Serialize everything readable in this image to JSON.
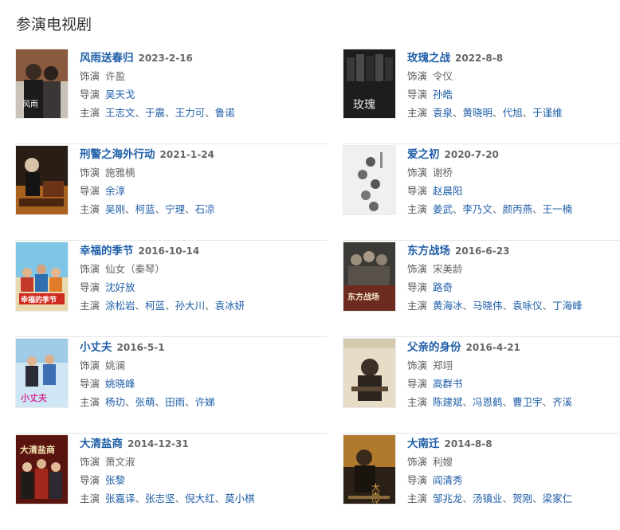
{
  "section_title": "参演电视剧",
  "labels": {
    "role": "饰演",
    "director": "导演",
    "cast": "主演"
  },
  "shows": [
    {
      "title": "风雨送春归",
      "date": "2023-2-16",
      "role": "许盈",
      "director": "吴天戈",
      "cast": [
        "王志文",
        "于震",
        "王力可",
        "鲁诺"
      ],
      "poster_title": "风雨"
    },
    {
      "title": "玫瑰之战",
      "date": "2022-8-8",
      "role": "令仪",
      "director": "孙皓",
      "cast": [
        "袁泉",
        "黄晓明",
        "代旭",
        "于谨维"
      ],
      "poster_title": "玫瑰"
    },
    {
      "title": "刑警之海外行动",
      "date": "2021-1-24",
      "role": "施雅楠",
      "director": "余淳",
      "cast": [
        "吴刚",
        "柯蓝",
        "宁理",
        "石凉"
      ],
      "poster_title": ""
    },
    {
      "title": "爱之初",
      "date": "2020-7-20",
      "role": "谢桥",
      "director": "赵晨阳",
      "cast": [
        "姜武",
        "李乃文",
        "颜丙燕",
        "王一楠"
      ],
      "poster_title": ""
    },
    {
      "title": "幸福的季节",
      "date": "2016-10-14",
      "role": "仙女（秦琴）",
      "director": "沈好放",
      "cast": [
        "涂松岩",
        "柯蓝",
        "孙大川",
        "袁冰妍"
      ],
      "poster_title": "幸福的季节"
    },
    {
      "title": "东方战场",
      "date": "2016-6-23",
      "role": "宋美龄",
      "director": "路奇",
      "cast": [
        "黄海冰",
        "马晓伟",
        "袁咏仪",
        "丁海峰"
      ],
      "poster_title": "东方战场"
    },
    {
      "title": "小丈夫",
      "date": "2016-5-1",
      "role": "姚澜",
      "director": "姚晓峰",
      "cast": [
        "杨玏",
        "张萌",
        "田雨",
        "许娣"
      ],
      "poster_title": "小丈夫"
    },
    {
      "title": "父亲的身份",
      "date": "2016-4-21",
      "role": "郑翊",
      "director": "高群书",
      "cast": [
        "陈建斌",
        "冯恩鹤",
        "曹卫宇",
        "齐溪"
      ],
      "poster_title": ""
    },
    {
      "title": "大清盐商",
      "date": "2014-12-31",
      "role": "萧文淑",
      "director": "张黎",
      "cast": [
        "张嘉译",
        "张志坚",
        "倪大红",
        "莫小棋"
      ],
      "poster_title": "大清盐商"
    },
    {
      "title": "大南迁",
      "date": "2014-8-8",
      "role": "利嫂",
      "director": "阎清秀",
      "cast": [
        "邹兆龙",
        "汤镇业",
        "贺刚",
        "梁家仁"
      ],
      "poster_title": "大南迁"
    }
  ],
  "colors": {
    "link": "#1f5ea8",
    "date": "#666666",
    "label": "#555555",
    "rule": "#e6e6e6"
  }
}
